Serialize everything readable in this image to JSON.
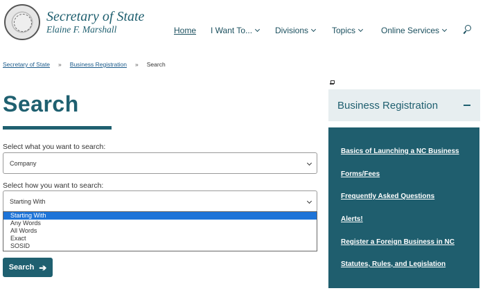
{
  "header": {
    "brand_title": "Secretary of State",
    "brand_subtitle": "Elaine F. Marshall",
    "nav": [
      {
        "label": "Home",
        "has_dropdown": false
      },
      {
        "label": "I Want To...",
        "has_dropdown": true
      },
      {
        "label": "Divisions",
        "has_dropdown": true
      },
      {
        "label": "Topics",
        "has_dropdown": true
      },
      {
        "label": "Online Services",
        "has_dropdown": true
      }
    ],
    "search_icon": "search-icon"
  },
  "breadcrumb": {
    "items": [
      "Secretary of State",
      "Business Registration",
      "Search"
    ],
    "separator": "»"
  },
  "main": {
    "title": "Search",
    "what_label": "Select what you want to search:",
    "what_value": "Company",
    "how_label": "Select how you want to search:",
    "how_value": "Starting With",
    "how_options": [
      "Starting With",
      "Any Words",
      "All Words",
      "Exact",
      "SOSID"
    ],
    "how_selected_index": 0,
    "search_button": "Search",
    "search_button_icon": "arrow-right-icon"
  },
  "sidebar": {
    "heading": "Business Registration",
    "links": [
      "Basics of Launching a NC Business",
      "Forms/Fees",
      "Frequently Asked Questions",
      "Alerts!",
      "Register a Foreign Business in NC",
      "Statutes, Rules, and Legislation"
    ]
  },
  "colors": {
    "teal": "#1f6070",
    "sidebar_bg": "#1f5e6e",
    "sidebar_head_bg": "#e7eef0",
    "option_highlight": "#1e74d8"
  }
}
